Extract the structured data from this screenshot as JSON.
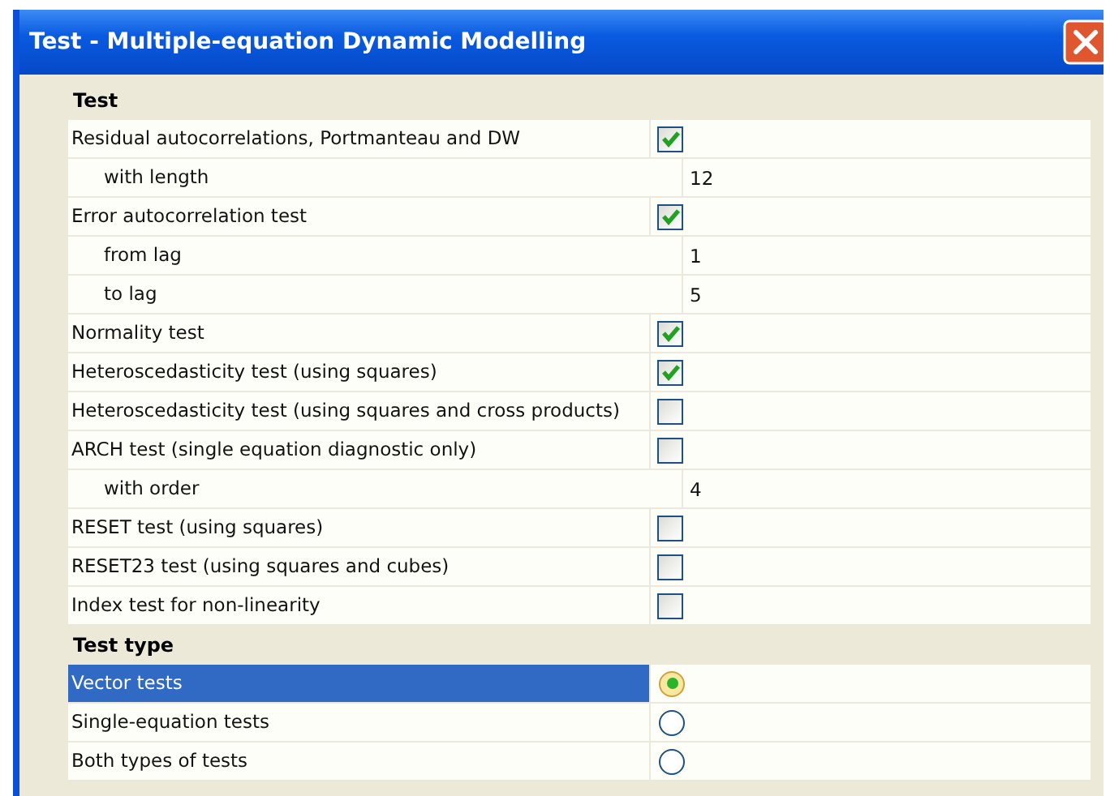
{
  "window": {
    "title": "Test - Multiple-equation Dynamic Modelling"
  },
  "sections": [
    {
      "title": "Test",
      "rows": [
        {
          "kind": "check",
          "label": "Residual autocorrelations, Portmanteau and DW",
          "checked": true,
          "children": [
            {
              "kind": "value",
              "label": "with length",
              "value": "12"
            }
          ]
        },
        {
          "kind": "check",
          "label": "Error autocorrelation test",
          "checked": true,
          "children": [
            {
              "kind": "value",
              "label": "from lag",
              "value": "1"
            },
            {
              "kind": "value",
              "label": "to lag",
              "value": "5"
            }
          ]
        },
        {
          "kind": "check",
          "label": "Normality test",
          "checked": true
        },
        {
          "kind": "check",
          "label": "Heteroscedasticity test (using squares)",
          "checked": true
        },
        {
          "kind": "check",
          "label": "Heteroscedasticity test (using squares and cross products)",
          "checked": false
        },
        {
          "kind": "check",
          "label": "ARCH test (single equation diagnostic only)",
          "checked": false,
          "children": [
            {
              "kind": "value",
              "label": "with order",
              "value": "4"
            }
          ]
        },
        {
          "kind": "check",
          "label": "RESET test (using squares)",
          "checked": false
        },
        {
          "kind": "check",
          "label": "RESET23 test (using squares and cubes)",
          "checked": false
        },
        {
          "kind": "check",
          "label": "Index test for non-linearity",
          "checked": false
        }
      ]
    },
    {
      "title": "Test type",
      "rows": [
        {
          "kind": "radio",
          "label": "Vector tests",
          "selected": true
        },
        {
          "kind": "radio",
          "label": "Single-equation tests",
          "selected": false
        },
        {
          "kind": "radio",
          "label": "Both types of tests",
          "selected": false
        }
      ]
    }
  ]
}
